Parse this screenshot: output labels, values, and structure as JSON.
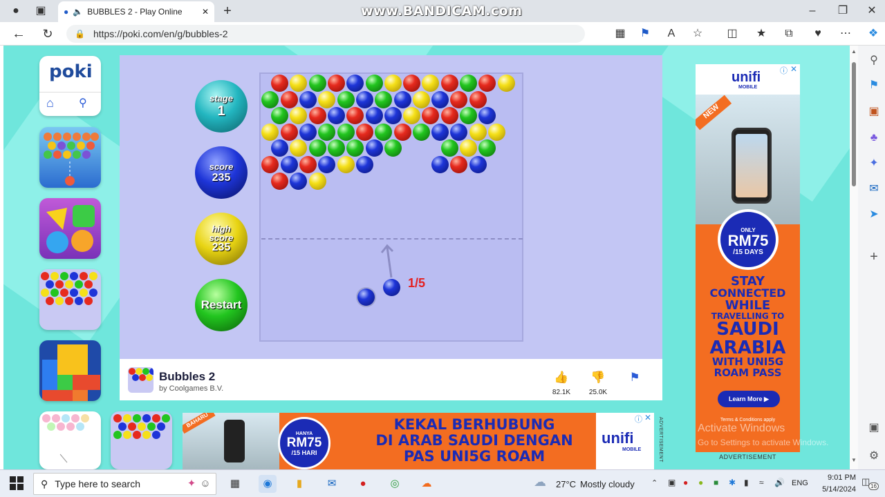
{
  "browser": {
    "tab_title": "BUBBLES 2 - Play Online for",
    "url": "https://poki.com/en/g/bubbles-2",
    "watermark": "www.BANDICAM.com"
  },
  "poki": {
    "logo": "poki"
  },
  "game": {
    "stage_label": "stage",
    "stage_value": "1",
    "score_label": "score",
    "score_value": "235",
    "high_label_1": "high",
    "high_label_2": "score",
    "high_value": "235",
    "restart_label": "Restart",
    "shots_counter": "1/5",
    "title": "Bubbles 2",
    "author": "by Coolgames B.V.",
    "likes": "82.1K",
    "dislikes": "25.0K",
    "colors": {
      "red": "#e62a1e",
      "yellow": "#f5e019",
      "green": "#22c51f",
      "blue": "#1e35d8"
    },
    "bubble_rows": [
      [
        "r",
        "y",
        "g",
        "r",
        "b",
        "g",
        "y",
        "r",
        "y",
        "r",
        "g",
        "r",
        "y"
      ],
      [
        "g",
        "r",
        "b",
        "y",
        "g",
        "b",
        "g",
        "b",
        "y",
        "b",
        "r",
        "r"
      ],
      [
        "g",
        "y",
        "r",
        "b",
        "r",
        "b",
        "b",
        "y",
        "r",
        "r",
        "g",
        "b"
      ],
      [
        "y",
        "r",
        "b",
        "g",
        "g",
        "r",
        "g",
        "r",
        "g",
        "b",
        "b",
        "y",
        "y"
      ],
      [
        "b",
        "y",
        "g",
        "g",
        "g",
        "b",
        "g",
        "",
        "",
        "g",
        "y",
        "g"
      ],
      [
        "r",
        "b",
        "r",
        "b",
        "y",
        "b",
        "",
        "",
        "",
        "b",
        "r",
        "b"
      ],
      [
        "r",
        "b",
        "y"
      ]
    ]
  },
  "ads": {
    "right": {
      "brand": "unifi",
      "brand_sub": "MOBILE",
      "badge": "NEW",
      "price_top": "ONLY",
      "price": "RM75",
      "price_sub": "/15 DAYS",
      "line1": "STAY",
      "line2": "CONNECTED",
      "line3": "WHILE",
      "line4": "TRAVELLING TO",
      "line5": "SAUDI",
      "line6": "ARABIA",
      "line7": "WITH UNI5G",
      "line8": "ROAM PASS",
      "cta": "Learn More",
      "terms": "Terms & Conditions apply",
      "label": "ADVERTISEMENT"
    },
    "bottom": {
      "badge": "BAHARU",
      "price_top": "HANYA",
      "price": "RM75",
      "price_sub": "/15 HARI",
      "line1": "KEKAL BERHUBUNG",
      "line2": "DI ARAB SAUDI DENGAN",
      "line3": "PAS UNI5G ROAM",
      "brand": "unifi",
      "brand_sub": "MOBILE",
      "label": "ADVERTISEMENT"
    }
  },
  "overlay": {
    "activate_title": "Activate Windows",
    "activate_sub": "Go to Settings to activate Windows."
  },
  "taskbar": {
    "search_placeholder": "Type here to search",
    "weather_temp": "27°C",
    "weather_desc": "Mostly cloudy",
    "lang": "ENG",
    "time": "9:01 PM",
    "date": "5/14/2024",
    "notifications": "16"
  }
}
